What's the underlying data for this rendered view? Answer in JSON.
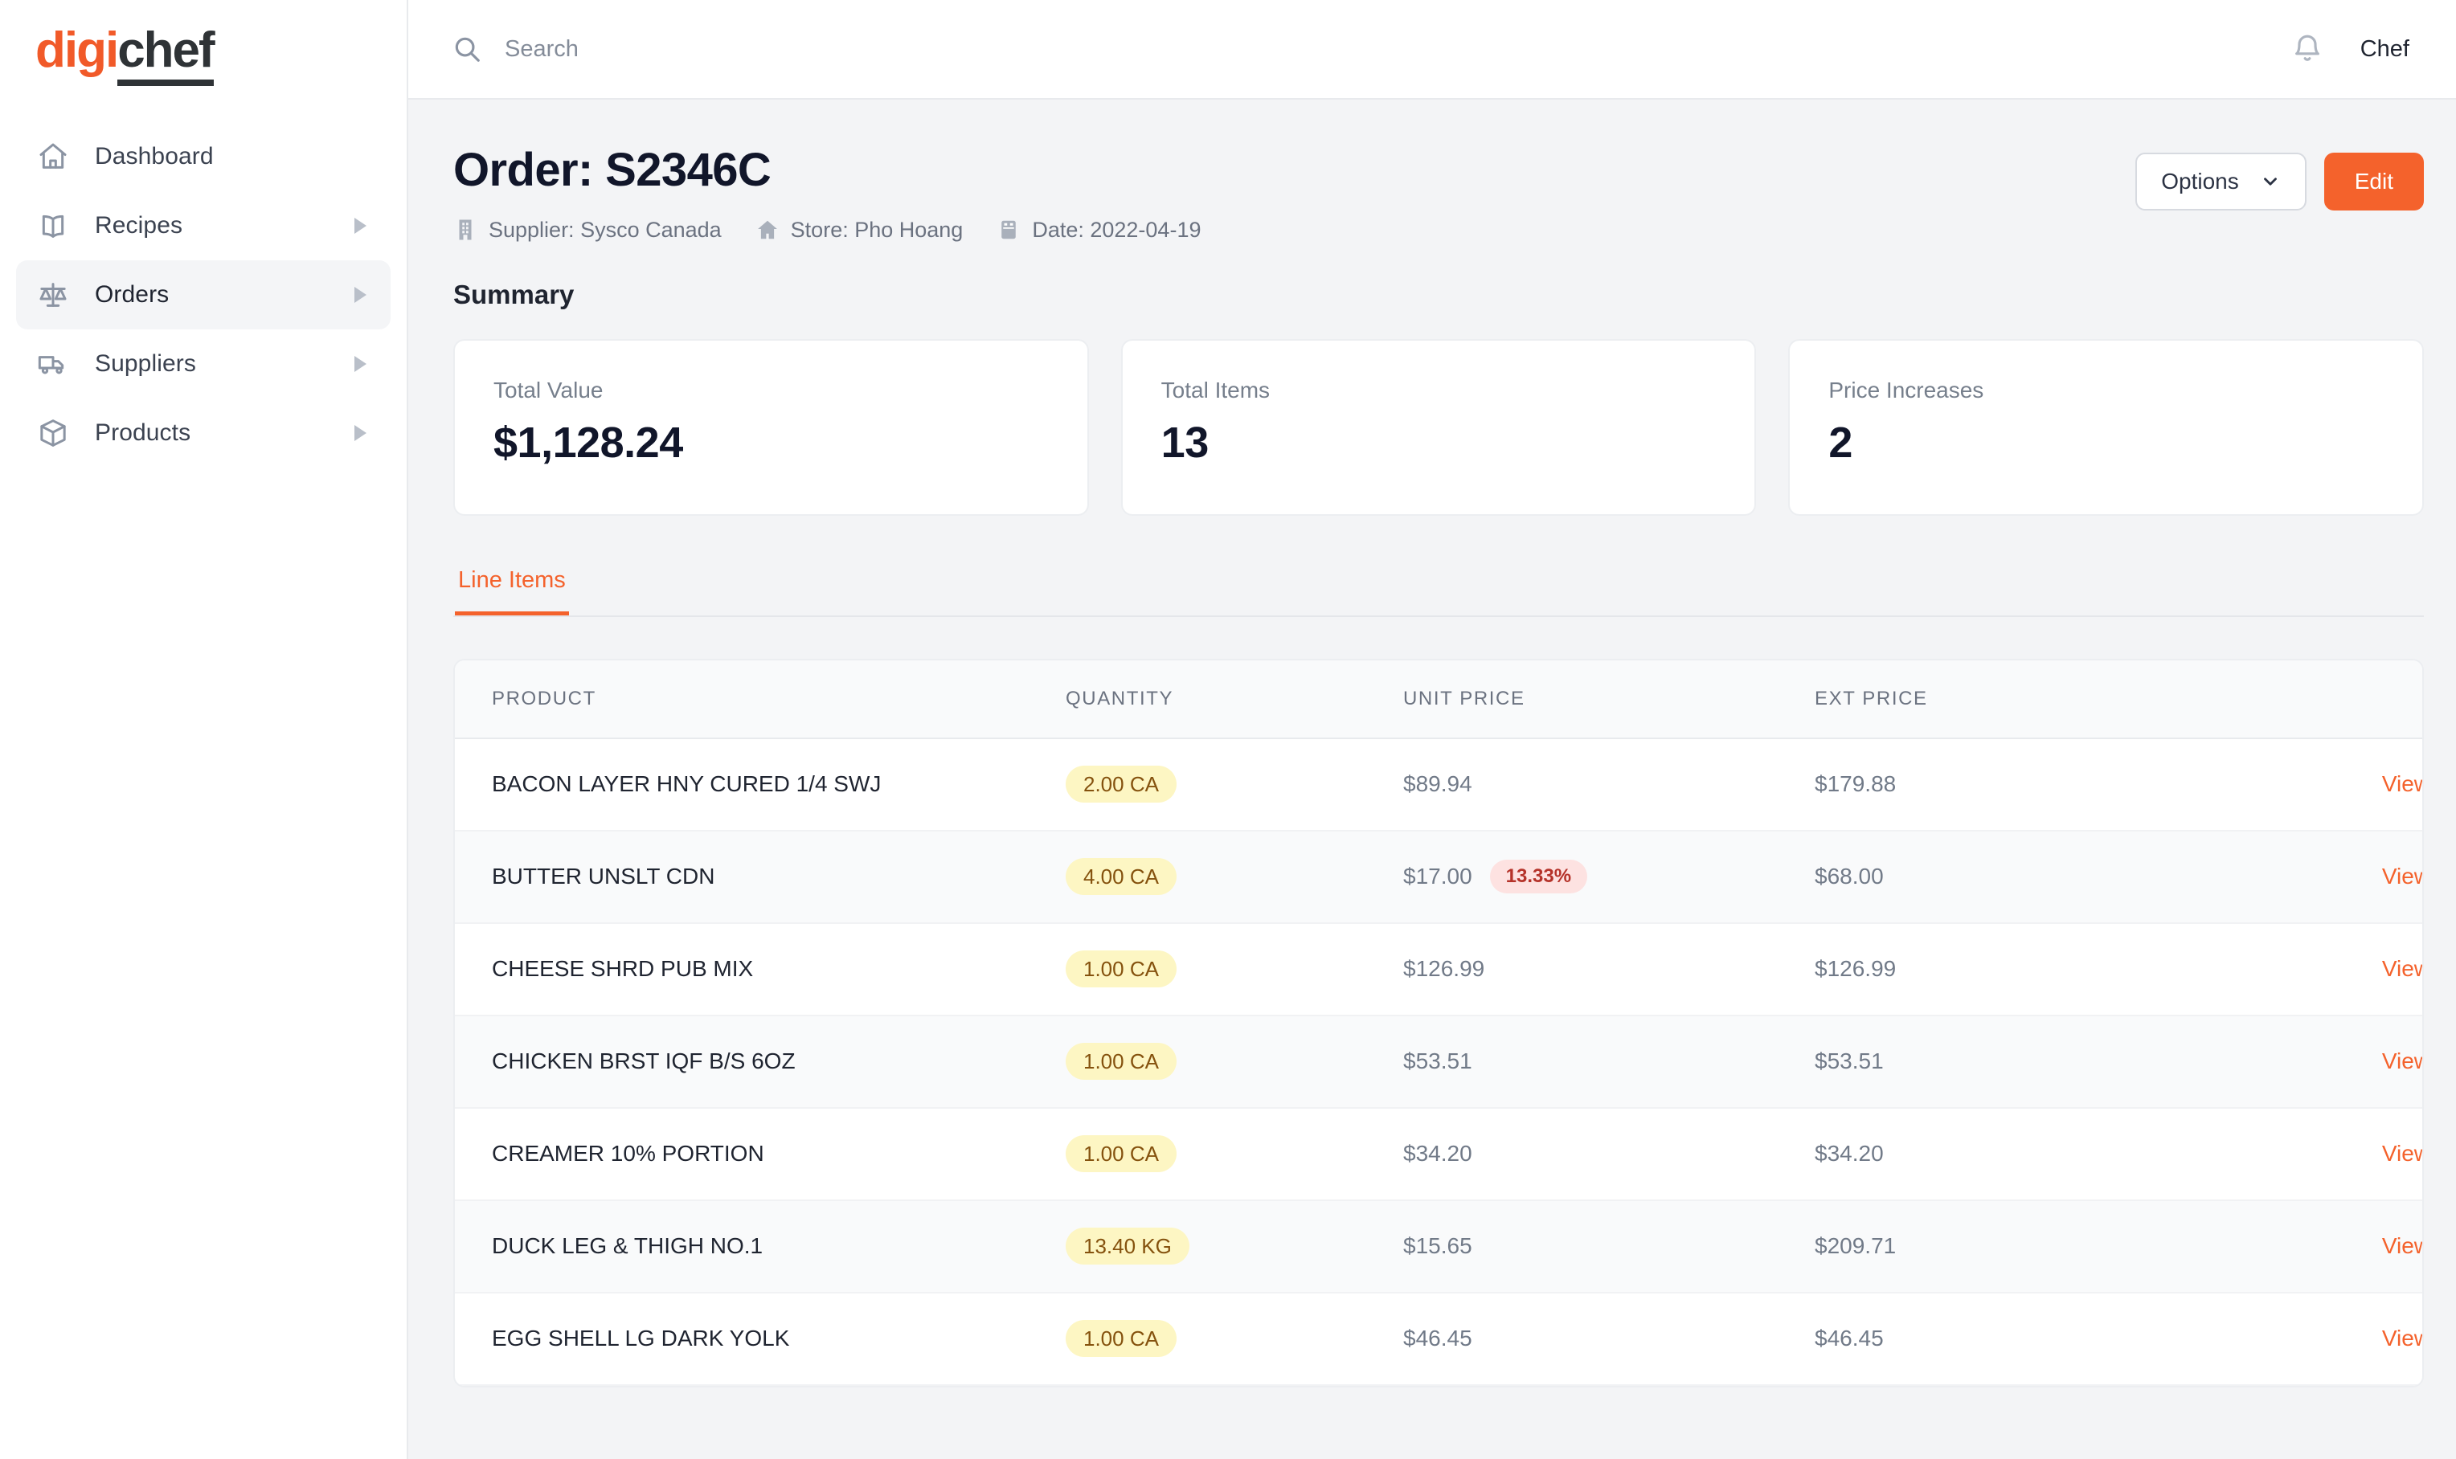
{
  "brand": {
    "part1": "digi",
    "part2": "chef"
  },
  "sidebar": {
    "items": [
      {
        "label": "Dashboard",
        "icon": "home-icon",
        "caret": false,
        "active": false
      },
      {
        "label": "Recipes",
        "icon": "book-icon",
        "caret": true,
        "active": false
      },
      {
        "label": "Orders",
        "icon": "scale-icon",
        "caret": true,
        "active": true
      },
      {
        "label": "Suppliers",
        "icon": "truck-icon",
        "caret": true,
        "active": false
      },
      {
        "label": "Products",
        "icon": "box-icon",
        "caret": true,
        "active": false
      }
    ]
  },
  "topbar": {
    "search_placeholder": "Search",
    "search_value": "",
    "user": "Chef"
  },
  "page": {
    "title": "Order: S2346C",
    "meta": [
      {
        "icon": "building-icon",
        "text": "Supplier: Sysco Canada"
      },
      {
        "icon": "home-icon",
        "text": "Store: Pho Hoang"
      },
      {
        "icon": "calendar-icon",
        "text": "Date: 2022-04-19"
      }
    ],
    "options_label": "Options",
    "edit_label": "Edit",
    "summary_title": "Summary",
    "cards": [
      {
        "label": "Total Value",
        "value": "$1,128.24"
      },
      {
        "label": "Total Items",
        "value": "13"
      },
      {
        "label": "Price Increases",
        "value": "2"
      }
    ],
    "tabs": [
      {
        "label": "Line Items",
        "active": true
      }
    ]
  },
  "table": {
    "columns": [
      "PRODUCT",
      "QUANTITY",
      "UNIT PRICE",
      "EXT PRICE",
      ""
    ],
    "action_label": "View",
    "rows": [
      {
        "product": "BACON LAYER HNY CURED 1/4 SWJ",
        "quantity": "2.00 CA",
        "unit_price": "$89.94",
        "pct": "",
        "ext_price": "$179.88",
        "action": "View"
      },
      {
        "product": "BUTTER UNSLT CDN",
        "quantity": "4.00 CA",
        "unit_price": "$17.00",
        "pct": "13.33%",
        "ext_price": "$68.00",
        "action": "View"
      },
      {
        "product": "CHEESE SHRD PUB MIX",
        "quantity": "1.00 CA",
        "unit_price": "$126.99",
        "pct": "",
        "ext_price": "$126.99",
        "action": "View"
      },
      {
        "product": "CHICKEN BRST IQF B/S 6OZ",
        "quantity": "1.00 CA",
        "unit_price": "$53.51",
        "pct": "",
        "ext_price": "$53.51",
        "action": "View"
      },
      {
        "product": "CREAMER 10% PORTION",
        "quantity": "1.00 CA",
        "unit_price": "$34.20",
        "pct": "",
        "ext_price": "$34.20",
        "action": "View"
      },
      {
        "product": "DUCK LEG & THIGH NO.1",
        "quantity": "13.40 KG",
        "unit_price": "$15.65",
        "pct": "",
        "ext_price": "$209.71",
        "action": "View"
      },
      {
        "product": "EGG SHELL LG DARK YOLK",
        "quantity": "1.00 CA",
        "unit_price": "$46.45",
        "pct": "",
        "ext_price": "$46.45",
        "action": "View"
      }
    ]
  },
  "colors": {
    "accent": "#f4622c",
    "brand_dark": "#2f3336",
    "badge_qty_bg": "#fdf6c3",
    "badge_qty_text": "#85520e",
    "badge_pct_bg": "#fde2e1",
    "badge_pct_text": "#b5332a",
    "page_bg": "#f3f4f6"
  }
}
